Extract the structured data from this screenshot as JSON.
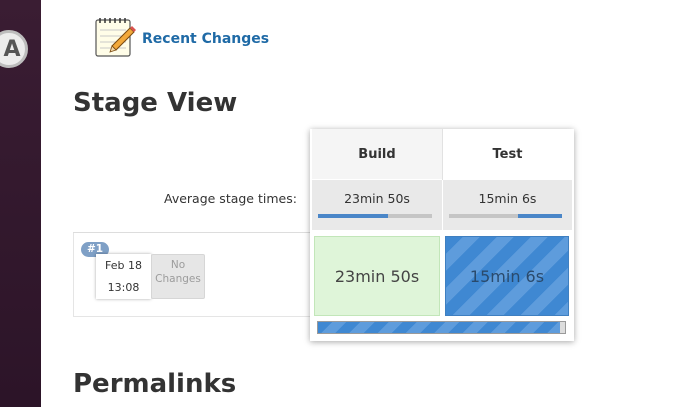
{
  "dock": {
    "app_icon": "ubuntu-software-icon",
    "app_letter": "A"
  },
  "recent_changes": {
    "icon": "notepad-pencil-icon",
    "label": "Recent Changes"
  },
  "stage_view": {
    "title": "Stage View",
    "average_label": "Average stage times:",
    "stages": [
      {
        "name": "Build",
        "average": "23min 50s",
        "avg_bar_fraction": 0.61
      },
      {
        "name": "Test",
        "average": "15min 6s",
        "avg_bar_fraction": 0.39
      }
    ],
    "runs": [
      {
        "badge": "#1",
        "date": "Feb 18",
        "time": "13:08",
        "changes": "No Changes",
        "cells": [
          {
            "duration": "23min 50s",
            "status": "success"
          },
          {
            "duration": "15min 6s",
            "status": "in-progress"
          }
        ],
        "progress_fraction": 0.98
      }
    ]
  },
  "permalinks": {
    "title": "Permalinks"
  },
  "colors": {
    "link": "#1f6aa6",
    "success": "#dff5d9",
    "in_progress": "#3f88d2",
    "sidebar": "#2c1428"
  }
}
